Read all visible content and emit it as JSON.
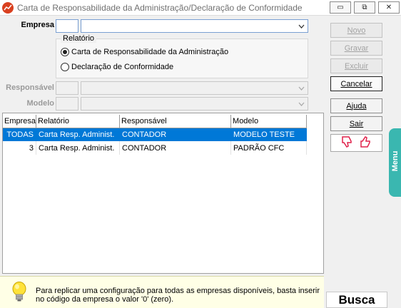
{
  "window": {
    "title": "Carta de Responsabilidade da Administração/Declaração de Conformidade",
    "minimize_glyph": "▭",
    "maximize_glyph": "⧉",
    "close_glyph": "✕"
  },
  "form": {
    "empresa_label": "Empresa",
    "responsavel_label": "Responsável",
    "modelo_label": "Modelo",
    "relatorio_group": {
      "title": "Relatório",
      "options": [
        {
          "label": "Carta de Responsabilidade da Administração",
          "checked": true
        },
        {
          "label": "Declaração de Conformidade",
          "checked": false
        }
      ]
    }
  },
  "grid": {
    "columns": [
      "Empresa",
      "Relatório",
      "Responsável",
      "Modelo"
    ],
    "rows": [
      {
        "empresa": "TODAS",
        "relatorio": "Carta Resp. Administ.",
        "responsavel": "CONTADOR",
        "modelo": "MODELO TESTE",
        "selected": true
      },
      {
        "empresa": "3",
        "relatorio": "Carta Resp. Administ.",
        "responsavel": "CONTADOR",
        "modelo": "PADRÃO CFC",
        "selected": false
      }
    ]
  },
  "buttons": {
    "novo": "Novo",
    "gravar": "Gravar",
    "excluir": "Excluir",
    "cancelar": "Cancelar",
    "ajuda": "Ajuda",
    "sair": "Sair"
  },
  "side": {
    "menu_label": "Menu",
    "busca_label": "Busca"
  },
  "hint": {
    "text": "Para replicar uma configuração para todas as empresas disponíveis, basta inserir no código da empresa o valor '0' (zero)."
  },
  "colors": {
    "selection": "#0078d7",
    "menu_tab": "#3ab7b0",
    "rating_icons": "#e0204a",
    "hint_background": "#ffffe6"
  }
}
